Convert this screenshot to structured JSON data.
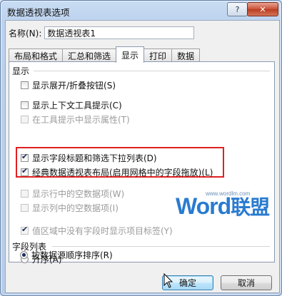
{
  "window": {
    "title": "数据透视表选项",
    "min_label": "?",
    "close_label": "✕"
  },
  "name": {
    "label": "名称(N):",
    "value": "数据透视表1"
  },
  "tabs": [
    {
      "label": "布局和格式"
    },
    {
      "label": "汇总和筛选"
    },
    {
      "label": "显示"
    },
    {
      "label": "打印"
    },
    {
      "label": "数据"
    }
  ],
  "display": {
    "group_title": "显示",
    "options": [
      {
        "label": "显示展开/折叠按钮(S)",
        "checked": false,
        "enabled": true
      },
      {
        "label": "显示上下文工具提示(C)",
        "checked": false,
        "enabled": true
      },
      {
        "label": "在工具提示中显示属性(T)",
        "checked": false,
        "enabled": false
      },
      {
        "label": "显示字段标题和筛选下拉列表(D)",
        "checked": true,
        "enabled": true
      },
      {
        "label": "经典数据透视表布局(启用网格中的字段拖放)(L)",
        "checked": true,
        "enabled": true
      },
      {
        "label": "显示行中的空数据项(W)",
        "checked": false,
        "enabled": false
      },
      {
        "label": "显示列中的空数据项(I)",
        "checked": false,
        "enabled": false
      },
      {
        "label": "值区域中没有字段时显示项目标签(Y)",
        "checked": true,
        "enabled": false
      }
    ]
  },
  "field_list": {
    "group_title": "字段列表",
    "options": [
      {
        "label": "升序(A)",
        "selected": false
      },
      {
        "label": "按数据源顺序排序(R)",
        "selected": true
      }
    ]
  },
  "buttons": {
    "ok": "确定",
    "cancel": "取消"
  },
  "watermark": {
    "brand": "Word",
    "brand_cn": "联盟",
    "url": "www.wordlm.com"
  },
  "colors": {
    "highlight": "#e02020",
    "accent": "#2a7bd0"
  }
}
